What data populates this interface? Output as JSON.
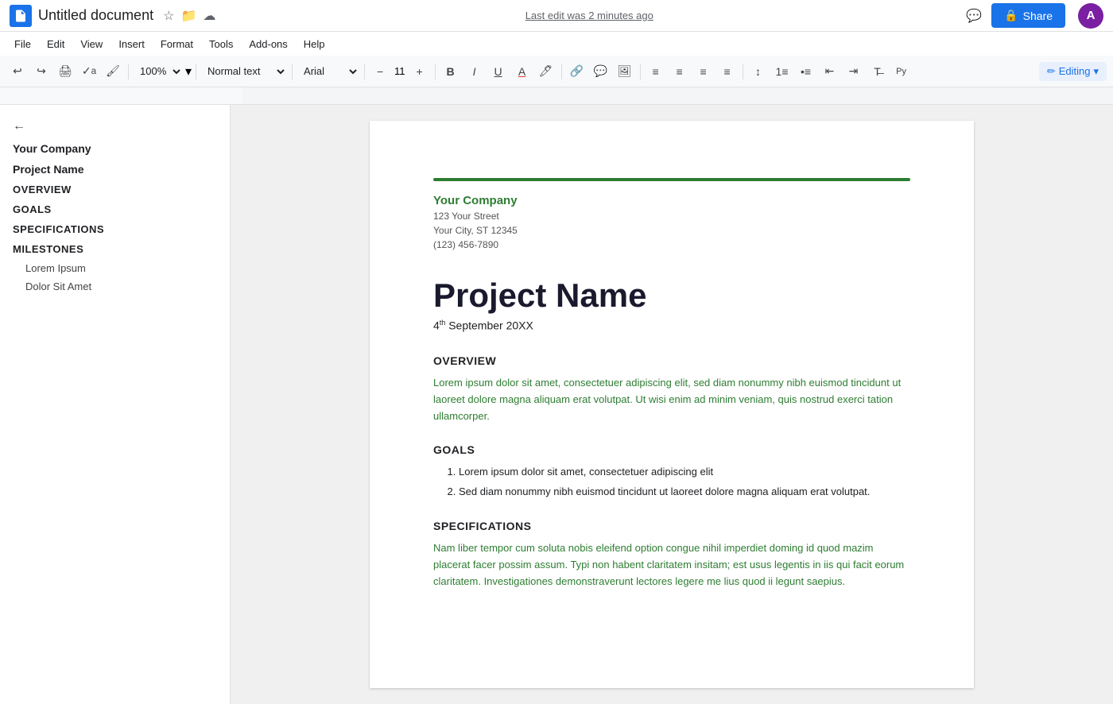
{
  "titlebar": {
    "doc_title": "Untitled document",
    "last_edit": "Last edit was 2 minutes ago",
    "share_label": "Share",
    "user_initial": "A"
  },
  "menubar": {
    "items": [
      "File",
      "Edit",
      "View",
      "Insert",
      "Format",
      "Tools",
      "Add-ons",
      "Help"
    ]
  },
  "toolbar": {
    "zoom": "100%",
    "text_style": "Normal text",
    "font": "Arial",
    "font_size": "11",
    "editing_label": "Editing"
  },
  "sidebar": {
    "back_label": "←",
    "items": [
      {
        "label": "Your Company",
        "level": "h1"
      },
      {
        "label": "Project Name",
        "level": "h1"
      },
      {
        "label": "OVERVIEW",
        "level": "section"
      },
      {
        "label": "GOALS",
        "level": "section"
      },
      {
        "label": "SPECIFICATIONS",
        "level": "section"
      },
      {
        "label": "MILESTONES",
        "level": "section"
      }
    ],
    "subitems": [
      {
        "label": "Lorem Ipsum"
      },
      {
        "label": "Dolor Sit Amet"
      }
    ]
  },
  "document": {
    "company_name": "Your Company",
    "address_line1": "123 Your Street",
    "address_line2": "Your City, ST 12345",
    "phone": "(123) 456-7890",
    "project_title": "Project Name",
    "project_date": "4th September 20XX",
    "sections": [
      {
        "id": "overview",
        "heading": "OVERVIEW",
        "body": "Lorem ipsum dolor sit amet, consectetuer adipiscing elit, sed diam nonummy nibh euismod tincidunt ut laoreet dolore magna aliquam erat volutpat. Ut wisi enim ad minim veniam, quis nostrud exerci tation ullamcorper."
      },
      {
        "id": "goals",
        "heading": "GOALS",
        "list": [
          "Lorem ipsum dolor sit amet, consectetuer adipiscing elit",
          "Sed diam nonummy nibh euismod tincidunt ut laoreet dolore magna aliquam erat volutpat."
        ]
      },
      {
        "id": "specifications",
        "heading": "SPECIFICATIONS",
        "body": "Nam liber tempor cum soluta nobis eleifend option congue nihil imperdiet doming id quod mazim placerat facer possim assum. Typi non habent claritatem insitam; est usus legentis in iis qui facit eorum claritatem. Investigationes demonstraverunt lectores legere me lius quod ii legunt saepius."
      }
    ]
  }
}
